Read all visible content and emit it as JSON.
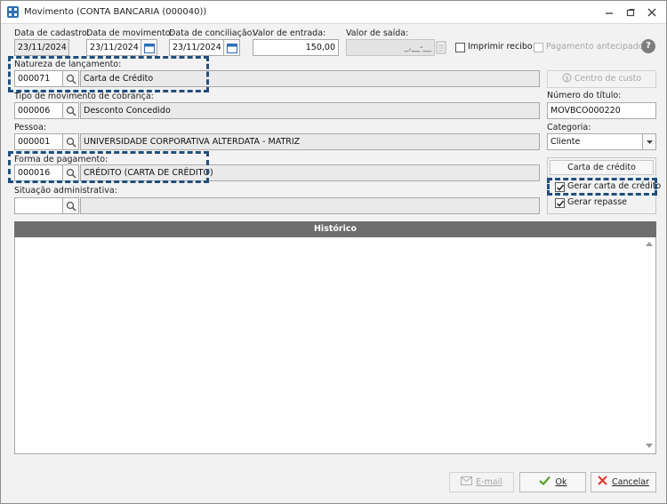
{
  "window": {
    "title": "Movimento (CONTA BANCARIA (000040))"
  },
  "labels": {
    "data_cadastro": "Data de cadastro:",
    "data_movimento": "Data de movimento:",
    "data_conciliacao": "Data de conciliação:",
    "valor_entrada": "Valor de entrada:",
    "valor_saida": "Valor de saída:",
    "natureza": "Natureza de lançamento:",
    "tipo_movimento": "Tipo de movimento de cobrança:",
    "numero_titulo": "Número do título:",
    "pessoa": "Pessoa:",
    "categoria": "Categoria:",
    "forma_pagamento": "Forma de pagamento:",
    "situacao": "Situação administrativa:"
  },
  "values": {
    "data_cadastro": "23/11/2024",
    "data_movimento": "23/11/2024",
    "data_conciliacao": "23/11/2024",
    "valor_entrada": "150,00",
    "valor_saida": "_,__-__",
    "natureza_codigo": "000071",
    "natureza_descricao": "Carta de Crédito",
    "tipo_codigo": "000006",
    "tipo_descricao": "Desconto Concedido",
    "numero_titulo": "MOVBCO000220",
    "pessoa_codigo": "000001",
    "pessoa_descricao": "UNIVERSIDADE CORPORATIVA ALTERDATA - MATRIZ",
    "categoria": "Cliente",
    "forma_codigo": "000016",
    "forma_descricao": "CRÉDITO (CARTA DE CRÉDITO)",
    "situacao_codigo": "",
    "situacao_descricao": ""
  },
  "checkboxes": {
    "imprimir_recibo": {
      "label": "Imprimir recibo",
      "checked": false
    },
    "pagamento_antecipado": {
      "label": "Pagamento antecipado",
      "checked": false,
      "disabled": true
    },
    "gerar_carta": {
      "label": "Gerar carta de crédito",
      "checked": true
    },
    "gerar_repasse": {
      "label": "Gerar repasse",
      "checked": true
    }
  },
  "buttons": {
    "centro_custo": "Centro de custo",
    "carta_credito": "Carta de crédito",
    "email": "E-mail",
    "ok": "Ok",
    "cancelar": "Cancelar",
    "help": "?"
  },
  "historico": {
    "header": "Histórico",
    "text": ""
  },
  "colors": {
    "highlight": "#1f4f7f",
    "header_bg": "#6e6e6e",
    "ok_check": "#5aa02c",
    "cancel_x": "#d83a2f"
  }
}
